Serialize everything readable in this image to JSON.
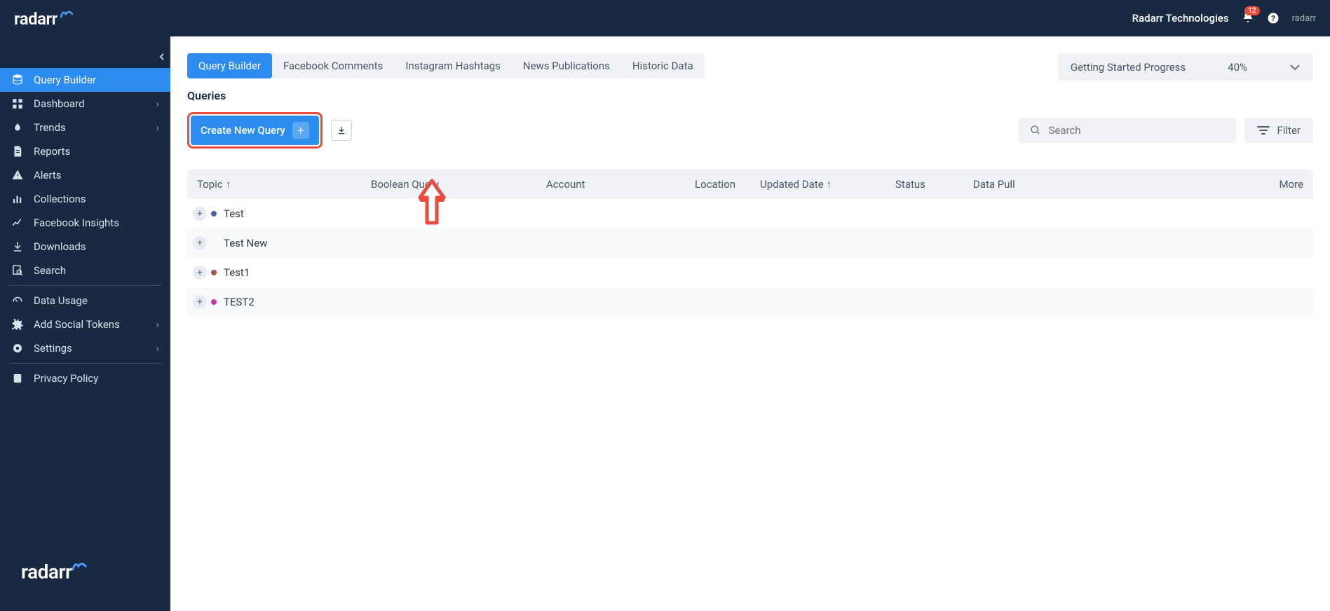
{
  "header": {
    "logo": "radarr",
    "company": "Radarr Technologies",
    "notification_count": "12",
    "small_logo": "radarr"
  },
  "sidebar": {
    "items": [
      {
        "label": "Query Builder",
        "icon": "database",
        "active": true,
        "chevron": false
      },
      {
        "label": "Dashboard",
        "icon": "grid",
        "active": false,
        "chevron": true
      },
      {
        "label": "Trends",
        "icon": "flame",
        "active": false,
        "chevron": true
      },
      {
        "label": "Reports",
        "icon": "document",
        "active": false,
        "chevron": false
      },
      {
        "label": "Alerts",
        "icon": "warning",
        "active": false,
        "chevron": false
      },
      {
        "label": "Collections",
        "icon": "chart",
        "active": false,
        "chevron": false
      },
      {
        "label": "Facebook Insights",
        "icon": "trend",
        "active": false,
        "chevron": false
      },
      {
        "label": "Downloads",
        "icon": "download",
        "active": false,
        "chevron": false
      },
      {
        "label": "Search",
        "icon": "search-doc",
        "active": false,
        "chevron": false
      },
      {
        "label": "Data Usage",
        "icon": "gauge",
        "active": false,
        "chevron": false,
        "divider_before": true
      },
      {
        "label": "Add Social Tokens",
        "icon": "cog",
        "active": false,
        "chevron": true
      },
      {
        "label": "Settings",
        "icon": "gear",
        "active": false,
        "chevron": true
      },
      {
        "label": "Privacy Policy",
        "icon": "shield",
        "active": false,
        "chevron": false,
        "divider_before": true
      }
    ],
    "footer_logo": "radarr"
  },
  "tabs": [
    {
      "label": "Query Builder",
      "active": true
    },
    {
      "label": "Facebook Comments",
      "active": false
    },
    {
      "label": "Instagram Hashtags",
      "active": false
    },
    {
      "label": "News Publications",
      "active": false
    },
    {
      "label": "Historic Data",
      "active": false
    }
  ],
  "progress": {
    "label": "Getting Started Progress",
    "value": "40%"
  },
  "section_title": "Queries",
  "create_button": "Create New Query",
  "search_placeholder": "Search",
  "filter_label": "Filter",
  "table": {
    "headers": {
      "topic": "Topic",
      "boolean": "Boolean Query",
      "account": "Account",
      "location": "Location",
      "updated": "Updated Date",
      "status": "Status",
      "datapull": "Data Pull",
      "more": "More"
    },
    "rows": [
      {
        "topic": "Test",
        "dot_color": "#4a5e9e"
      },
      {
        "topic": "Test New",
        "dot_color": ""
      },
      {
        "topic": "Test1",
        "dot_color": "#a0564a"
      },
      {
        "topic": "TEST2",
        "dot_color": "#c236a8"
      }
    ]
  }
}
